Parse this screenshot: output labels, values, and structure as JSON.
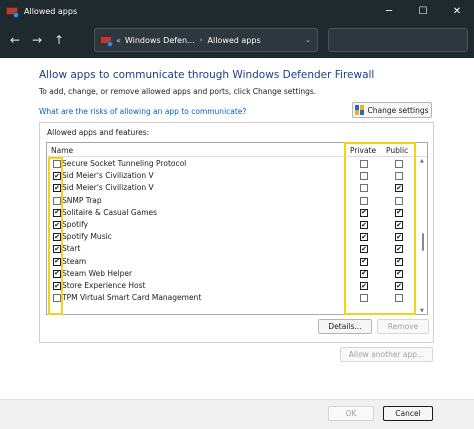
{
  "window": {
    "title": "Allowed apps",
    "controls": {
      "minimize": "─",
      "maximize": "☐",
      "close": "✕"
    }
  },
  "navigation": {
    "back": "←",
    "forward": "→",
    "up": "↑",
    "refresh": "↻",
    "breadcrumb_separator": "«",
    "breadcrumb": [
      "Windows Defen...",
      "Allowed apps"
    ],
    "breadcrumb_chevron": "›",
    "dropdown": "⌄"
  },
  "content": {
    "heading": "Allow apps to communicate through Windows Defender Firewall",
    "subtext": "To add, change, or remove allowed apps and ports, click Change settings.",
    "risk_link": "What are the risks of allowing an app to communicate?",
    "change_settings_label": "Change settings"
  },
  "group": {
    "label": "Allowed apps and features:",
    "columns": {
      "name": "Name",
      "private": "Private",
      "public": "Public"
    },
    "rows": [
      {
        "name": "Secure Socket Tunneling Protocol",
        "enabled": false,
        "private": false,
        "public": false
      },
      {
        "name": "Sid Meier's Civilization V",
        "enabled": true,
        "private": false,
        "public": false
      },
      {
        "name": "Sid Meier's Civilization V",
        "enabled": true,
        "private": false,
        "public": true
      },
      {
        "name": "SNMP Trap",
        "enabled": false,
        "private": false,
        "public": false
      },
      {
        "name": "Solitaire & Casual Games",
        "enabled": true,
        "private": true,
        "public": true
      },
      {
        "name": "Spotify",
        "enabled": true,
        "private": true,
        "public": true
      },
      {
        "name": "Spotify Music",
        "enabled": true,
        "private": true,
        "public": true
      },
      {
        "name": "Start",
        "enabled": true,
        "private": true,
        "public": true
      },
      {
        "name": "Steam",
        "enabled": true,
        "private": true,
        "public": true
      },
      {
        "name": "Steam Web Helper",
        "enabled": true,
        "private": true,
        "public": true
      },
      {
        "name": "Store Experience Host",
        "enabled": true,
        "private": true,
        "public": true
      },
      {
        "name": "TPM Virtual Smart Card Management",
        "enabled": false,
        "private": false,
        "public": false
      }
    ],
    "checkmark": "✔",
    "scroll_up": "▲",
    "scroll_down": "▼"
  },
  "buttons": {
    "details": "Details...",
    "remove": "Remove",
    "allow_another": "Allow another app...",
    "ok": "OK",
    "cancel": "Cancel"
  },
  "colors": {
    "highlight": "#f2d21a",
    "heading": "#1a3e8a",
    "link": "#0b5cc7",
    "titlebar": "#1f2a2e"
  }
}
